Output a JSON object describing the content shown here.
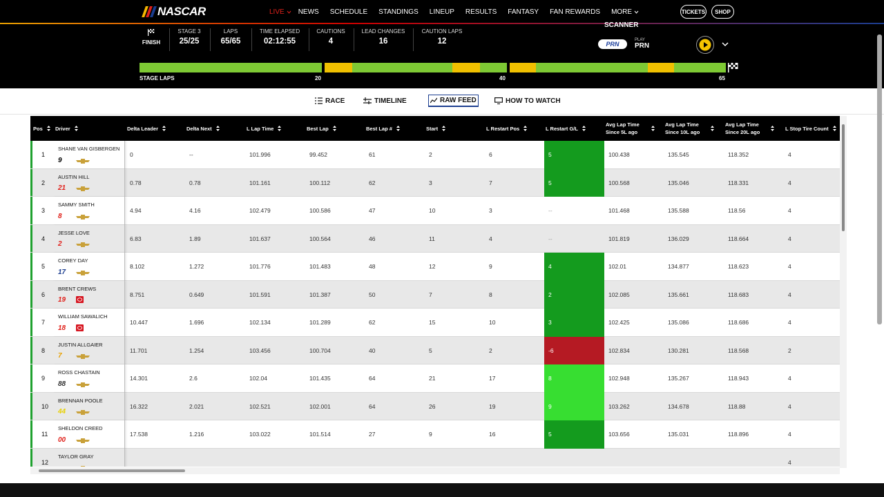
{
  "nav": {
    "logo_text": "NASCAR",
    "links": [
      "LIVE",
      "NEWS",
      "SCHEDULE",
      "STANDINGS",
      "LINEUP",
      "RESULTS",
      "FANTASY",
      "FAN REWARDS",
      "MORE"
    ],
    "tickets": "TICKETS",
    "shop": "SHOP"
  },
  "race": {
    "finish_label": "FINISH",
    "stats": [
      {
        "label": "STAGE 3",
        "value": "25/25"
      },
      {
        "label": "LAPS",
        "value": "65/65"
      },
      {
        "label": "TIME ELAPSED",
        "value": "02:12:55"
      },
      {
        "label": "CAUTIONS",
        "value": "4"
      },
      {
        "label": "LEAD CHANGES",
        "value": "16"
      },
      {
        "label": "CAUTION LAPS",
        "value": "12"
      }
    ],
    "scanner_label": "SCANNER",
    "prn_logo": "PRN",
    "prn_play_label": "PLAY",
    "prn_name": "PRN",
    "stage_laps_label": "STAGE LAPS",
    "stage_marks": [
      "20",
      "40",
      "65"
    ]
  },
  "tabs": [
    "RACE",
    "TIMELINE",
    "RAW FEED",
    "HOW TO WATCH"
  ],
  "colors": {
    "positive_dark": "#149b1e",
    "positive_light": "#37de31",
    "negative": "#b51a23",
    "flag_green": "#7ec934",
    "flag_yellow": "#f0c000"
  },
  "table": {
    "headers": [
      "Pos",
      "Driver",
      "Delta Leader",
      "Delta Next",
      "L Lap Time",
      "Best Lap",
      "Best Lap #",
      "Start",
      "L Restart Pos",
      "L Restart G/L",
      "Avg Lap Time Since 5L ago",
      "Avg Lap Time Since 10L ago",
      "Avg Lap Time Since 20L ago",
      "L Stop Tire Count"
    ],
    "rows": [
      {
        "pos": "1",
        "driver": "SHANE VAN GISBERGEN",
        "num": "9",
        "delta_leader": "0",
        "delta_next": "--",
        "l_lap": "101.996",
        "best_lap": "99.452",
        "best_lap_num": "61",
        "start": "2",
        "restart_pos": "6",
        "restart_gl": "5",
        "avg5": "100.438",
        "avg10": "135.545",
        "avg20": "118.352",
        "tires": "4"
      },
      {
        "pos": "2",
        "driver": "AUSTIN HILL",
        "num": "21",
        "delta_leader": "0.78",
        "delta_next": "0.78",
        "l_lap": "101.161",
        "best_lap": "100.112",
        "best_lap_num": "62",
        "start": "3",
        "restart_pos": "7",
        "restart_gl": "5",
        "avg5": "100.568",
        "avg10": "135.046",
        "avg20": "118.331",
        "tires": "4"
      },
      {
        "pos": "3",
        "driver": "SAMMY SMITH",
        "num": "8",
        "delta_leader": "4.94",
        "delta_next": "4.16",
        "l_lap": "102.479",
        "best_lap": "100.586",
        "best_lap_num": "47",
        "start": "10",
        "restart_pos": "3",
        "restart_gl": "--",
        "avg5": "101.468",
        "avg10": "135.588",
        "avg20": "118.56",
        "tires": "4"
      },
      {
        "pos": "4",
        "driver": "JESSE LOVE",
        "num": "2",
        "delta_leader": "6.83",
        "delta_next": "1.89",
        "l_lap": "101.637",
        "best_lap": "100.564",
        "best_lap_num": "46",
        "start": "11",
        "restart_pos": "4",
        "restart_gl": "--",
        "avg5": "101.819",
        "avg10": "136.029",
        "avg20": "118.664",
        "tires": "4"
      },
      {
        "pos": "5",
        "driver": "COREY DAY",
        "num": "17",
        "delta_leader": "8.102",
        "delta_next": "1.272",
        "l_lap": "101.776",
        "best_lap": "101.483",
        "best_lap_num": "48",
        "start": "12",
        "restart_pos": "9",
        "restart_gl": "4",
        "avg5": "102.01",
        "avg10": "134.877",
        "avg20": "118.623",
        "tires": "4"
      },
      {
        "pos": "6",
        "driver": "BRENT CREWS",
        "num": "19",
        "delta_leader": "8.751",
        "delta_next": "0.649",
        "l_lap": "101.591",
        "best_lap": "101.387",
        "best_lap_num": "50",
        "start": "7",
        "restart_pos": "8",
        "restart_gl": "2",
        "avg5": "102.085",
        "avg10": "135.661",
        "avg20": "118.683",
        "tires": "4"
      },
      {
        "pos": "7",
        "driver": "WILLIAM SAWALICH",
        "num": "18",
        "delta_leader": "10.447",
        "delta_next": "1.696",
        "l_lap": "102.134",
        "best_lap": "101.289",
        "best_lap_num": "62",
        "start": "15",
        "restart_pos": "10",
        "restart_gl": "3",
        "avg5": "102.425",
        "avg10": "135.086",
        "avg20": "118.686",
        "tires": "4"
      },
      {
        "pos": "8",
        "driver": "JUSTIN ALLGAIER",
        "num": "7",
        "delta_leader": "11.701",
        "delta_next": "1.254",
        "l_lap": "103.456",
        "best_lap": "100.704",
        "best_lap_num": "40",
        "start": "5",
        "restart_pos": "2",
        "restart_gl": "-6",
        "avg5": "102.834",
        "avg10": "130.281",
        "avg20": "118.568",
        "tires": "2"
      },
      {
        "pos": "9",
        "driver": "ROSS CHASTAIN",
        "num": "88",
        "delta_leader": "14.301",
        "delta_next": "2.6",
        "l_lap": "102.04",
        "best_lap": "101.435",
        "best_lap_num": "64",
        "start": "21",
        "restart_pos": "17",
        "restart_gl": "8",
        "avg5": "102.948",
        "avg10": "135.267",
        "avg20": "118.943",
        "tires": "4"
      },
      {
        "pos": "10",
        "driver": "BRENNAN POOLE",
        "num": "44",
        "delta_leader": "16.322",
        "delta_next": "2.021",
        "l_lap": "102.521",
        "best_lap": "102.001",
        "best_lap_num": "64",
        "start": "26",
        "restart_pos": "19",
        "restart_gl": "9",
        "avg5": "103.262",
        "avg10": "134.678",
        "avg20": "118.88",
        "tires": "4"
      },
      {
        "pos": "11",
        "driver": "SHELDON CREED",
        "num": "00",
        "delta_leader": "17.538",
        "delta_next": "1.216",
        "l_lap": "103.022",
        "best_lap": "101.514",
        "best_lap_num": "27",
        "start": "9",
        "restart_pos": "16",
        "restart_gl": "5",
        "avg5": "103.656",
        "avg10": "135.031",
        "avg20": "118.896",
        "tires": "4"
      },
      {
        "pos": "12",
        "driver": "TAYLOR GRAY",
        "num": "",
        "delta_leader": "",
        "delta_next": "",
        "l_lap": "",
        "best_lap": "",
        "best_lap_num": "",
        "start": "",
        "restart_pos": "",
        "restart_gl": "",
        "avg5": "",
        "avg10": "",
        "avg20": "",
        "tires": "4"
      }
    ]
  }
}
